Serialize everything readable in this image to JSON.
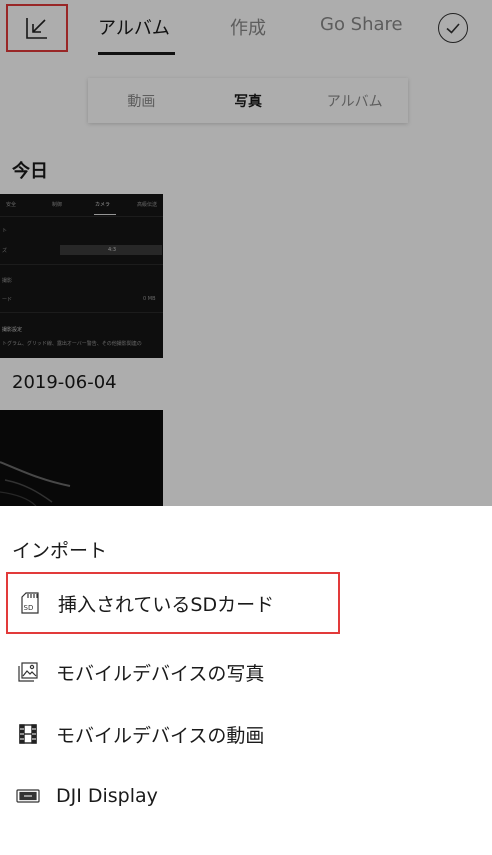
{
  "topbar": {
    "import_icon": "import-arrow-icon",
    "tabs": [
      {
        "label": "アルバム",
        "active": true
      },
      {
        "label": "作成",
        "active": false
      },
      {
        "label": "Go Share",
        "active": false
      }
    ],
    "select_icon": "check-circle-icon"
  },
  "segments": [
    {
      "label": "動画",
      "active": false
    },
    {
      "label": "写真",
      "active": true
    },
    {
      "label": "アルバム",
      "active": false
    }
  ],
  "gallery": {
    "sections": [
      {
        "title": "今日"
      },
      {
        "title": "2019-06-04"
      }
    ],
    "thumbnail_text": {
      "tabs": [
        "安全",
        "制御",
        "カメラ",
        "高級伝送"
      ],
      "rows": [
        "ト",
        "ズ",
        "4:3",
        "撮影",
        "ード",
        "0 MB",
        "撮影設定",
        "トグラム、グリッド線、露出オーバー警告、その他撮影関連の"
      ]
    }
  },
  "import_sheet": {
    "title": "インポート",
    "options": [
      {
        "label": "挿入されているSDカード",
        "icon": "sd-card-icon"
      },
      {
        "label": "モバイルデバイスの写真",
        "icon": "photo-icon"
      },
      {
        "label": "モバイルデバイスの動画",
        "icon": "film-icon"
      },
      {
        "label": "DJI Display",
        "icon": "dji-display-icon"
      }
    ]
  },
  "colors": {
    "highlight": "#e23a3a",
    "text": "#1a1a1a",
    "muted": "#8a8a8a",
    "overlay": "rgba(0,0,0,0.32)"
  }
}
